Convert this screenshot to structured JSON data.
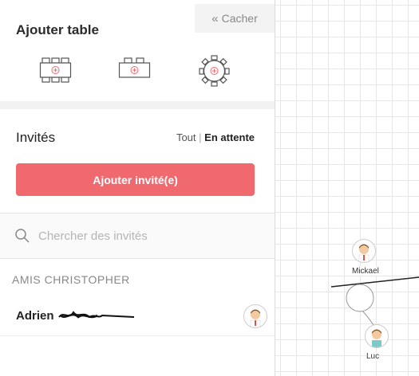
{
  "panel": {
    "hide_label": "Cacher",
    "add_table_title": "Ajouter table",
    "table_types": [
      "rectangle-table-icon",
      "small-rectangle-table-icon",
      "round-table-icon"
    ],
    "guests_title": "Invités",
    "filter_all": "Tout",
    "filter_separator": "|",
    "filter_pending": "En attente",
    "add_guest_label": "Ajouter invité(e)",
    "search_placeholder": "Chercher des invités",
    "group_name": "AMIS CHRISTOPHER",
    "guests": [
      {
        "name": "Adrien"
      }
    ]
  },
  "canvas": {
    "nodes": [
      {
        "label": "Mickael"
      },
      {
        "label": "Luc"
      }
    ]
  },
  "colors": {
    "accent": "#f0696e",
    "panel_bg": "#ffffff",
    "grid": "#e6e6e6"
  }
}
